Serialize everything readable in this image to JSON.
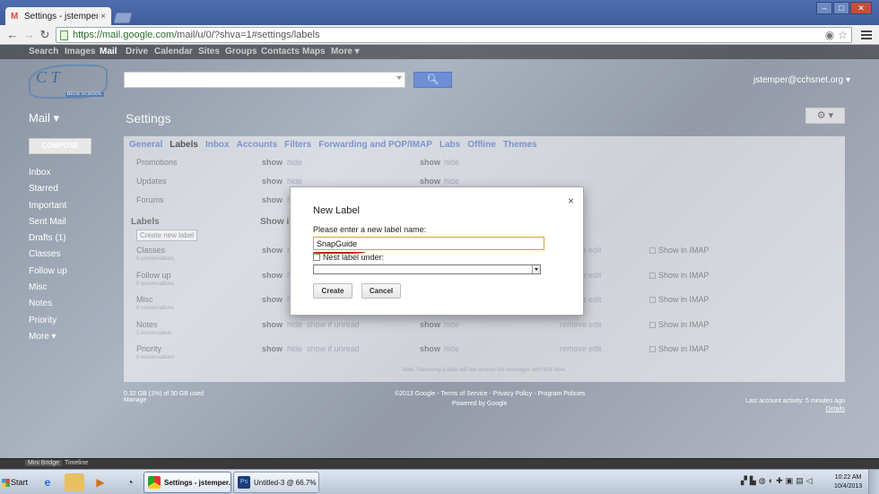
{
  "browser": {
    "tab_title": "Settings - jstemper@cchs",
    "tab_close": "×",
    "url_host": "https://mail.google.com",
    "url_rest": "/mail/u/0/?shva=1#settings/labels",
    "win_minimize": "–",
    "win_maximize": "□",
    "win_close": "✕"
  },
  "gbar": [
    "Search",
    "Images",
    "Mail",
    "Drive",
    "Calendar",
    "Sites",
    "Groups",
    "Contacts",
    "Maps",
    "More ▾"
  ],
  "header": {
    "logo_text": "C T",
    "logo_sub": "HIGH SCHOOL",
    "account": "jstemper@cchsnet.org ▾",
    "search_button_icon": "search-icon"
  },
  "left": {
    "mail_menu": "Mail ▾",
    "compose": "COMPOSE",
    "nav": [
      "Inbox",
      "Starred",
      "Important",
      "Sent Mail",
      "Drafts (1)",
      "Classes",
      "Follow up",
      "Misc",
      "Notes",
      "Priority",
      "More ▾"
    ]
  },
  "settings": {
    "title": "Settings",
    "gear": "⚙ ▾",
    "tabs": [
      "General",
      "Labels",
      "Inbox",
      "Accounts",
      "Filters",
      "Forwarding and POP/IMAP",
      "Labs",
      "Offline",
      "Themes"
    ],
    "active_tab": "Labels",
    "system_rows": [
      {
        "name": "Promotions",
        "show": "show",
        "hide": "hide",
        "show2": "show",
        "hide2": "hide"
      },
      {
        "name": "Updates",
        "show": "show",
        "hide": "hide",
        "show2": "show",
        "hide2": "hide"
      },
      {
        "name": "Forums",
        "show": "show",
        "hide": "hi",
        "show2": "show",
        "hide2": "hide"
      }
    ],
    "labels_header": "Labels",
    "labels_show_header": "Show in",
    "create_new_label": "Create new label",
    "label_rows": [
      {
        "name": "Classes",
        "conv": "0 conversations",
        "show": "show",
        "hide": "hi",
        "unread": "",
        "show2": "show",
        "hide2": "hide",
        "remove": "remove",
        "edit": "edit",
        "imap": "Show in IMAP"
      },
      {
        "name": "Follow up",
        "conv": "0 conversations",
        "show": "show",
        "hide": "hi",
        "unread": "",
        "show2": "show",
        "hide2": "hide",
        "remove": "remove",
        "edit": "edit",
        "imap": "Show in IMAP"
      },
      {
        "name": "Misc",
        "conv": "0 conversations",
        "show": "show",
        "hide": "hi",
        "unread": "",
        "show2": "show",
        "hide2": "hide",
        "remove": "remove",
        "edit": "edit",
        "imap": "Show in IMAP"
      },
      {
        "name": "Notes",
        "conv": "1 conversation",
        "show": "show",
        "hide": "hide",
        "unread": "show if unread",
        "show2": "show",
        "hide2": "hide",
        "remove": "remove",
        "edit": "edit",
        "imap": "Show in IMAP"
      },
      {
        "name": "Priority",
        "conv": "0 conversations",
        "show": "show",
        "hide": "hide",
        "unread": "show if unread",
        "show2": "show",
        "hide2": "hide",
        "remove": "remove",
        "edit": "edit",
        "imap": "Show in IMAP"
      }
    ],
    "note": "Note: Removing a label will not remove the messages with that label."
  },
  "footer": {
    "left_line1": "0.32 GB (1%) of 30 GB used",
    "left_line2": "Manage",
    "center_line1": "©2013 Google - Terms of Service - Privacy Policy - Program Policies",
    "center_line2": "Powered by Google",
    "right_line1": "Last account activity: 5 minutes ago",
    "right_line2": "Details"
  },
  "modal": {
    "title": "New Label",
    "close": "×",
    "prompt": "Please enter a new label name:",
    "input_value": "SnapGuide",
    "nest_label": "Nest label under:",
    "nest_value": "",
    "create": "Create",
    "cancel": "Cancel"
  },
  "photoshop_strip": {
    "tabs": [
      "Mini Bridge",
      "Timeline"
    ]
  },
  "taskbar": {
    "start": "Start",
    "tasks": [
      {
        "label": "Settings - jstemper...",
        "icon_color": "#3b8de0"
      },
      {
        "label": "Untitled-3 @ 66.7% ...",
        "icon_color": "#1a3d7a"
      }
    ],
    "clock_time": "10:22 AM",
    "clock_date": "10/4/2013"
  }
}
